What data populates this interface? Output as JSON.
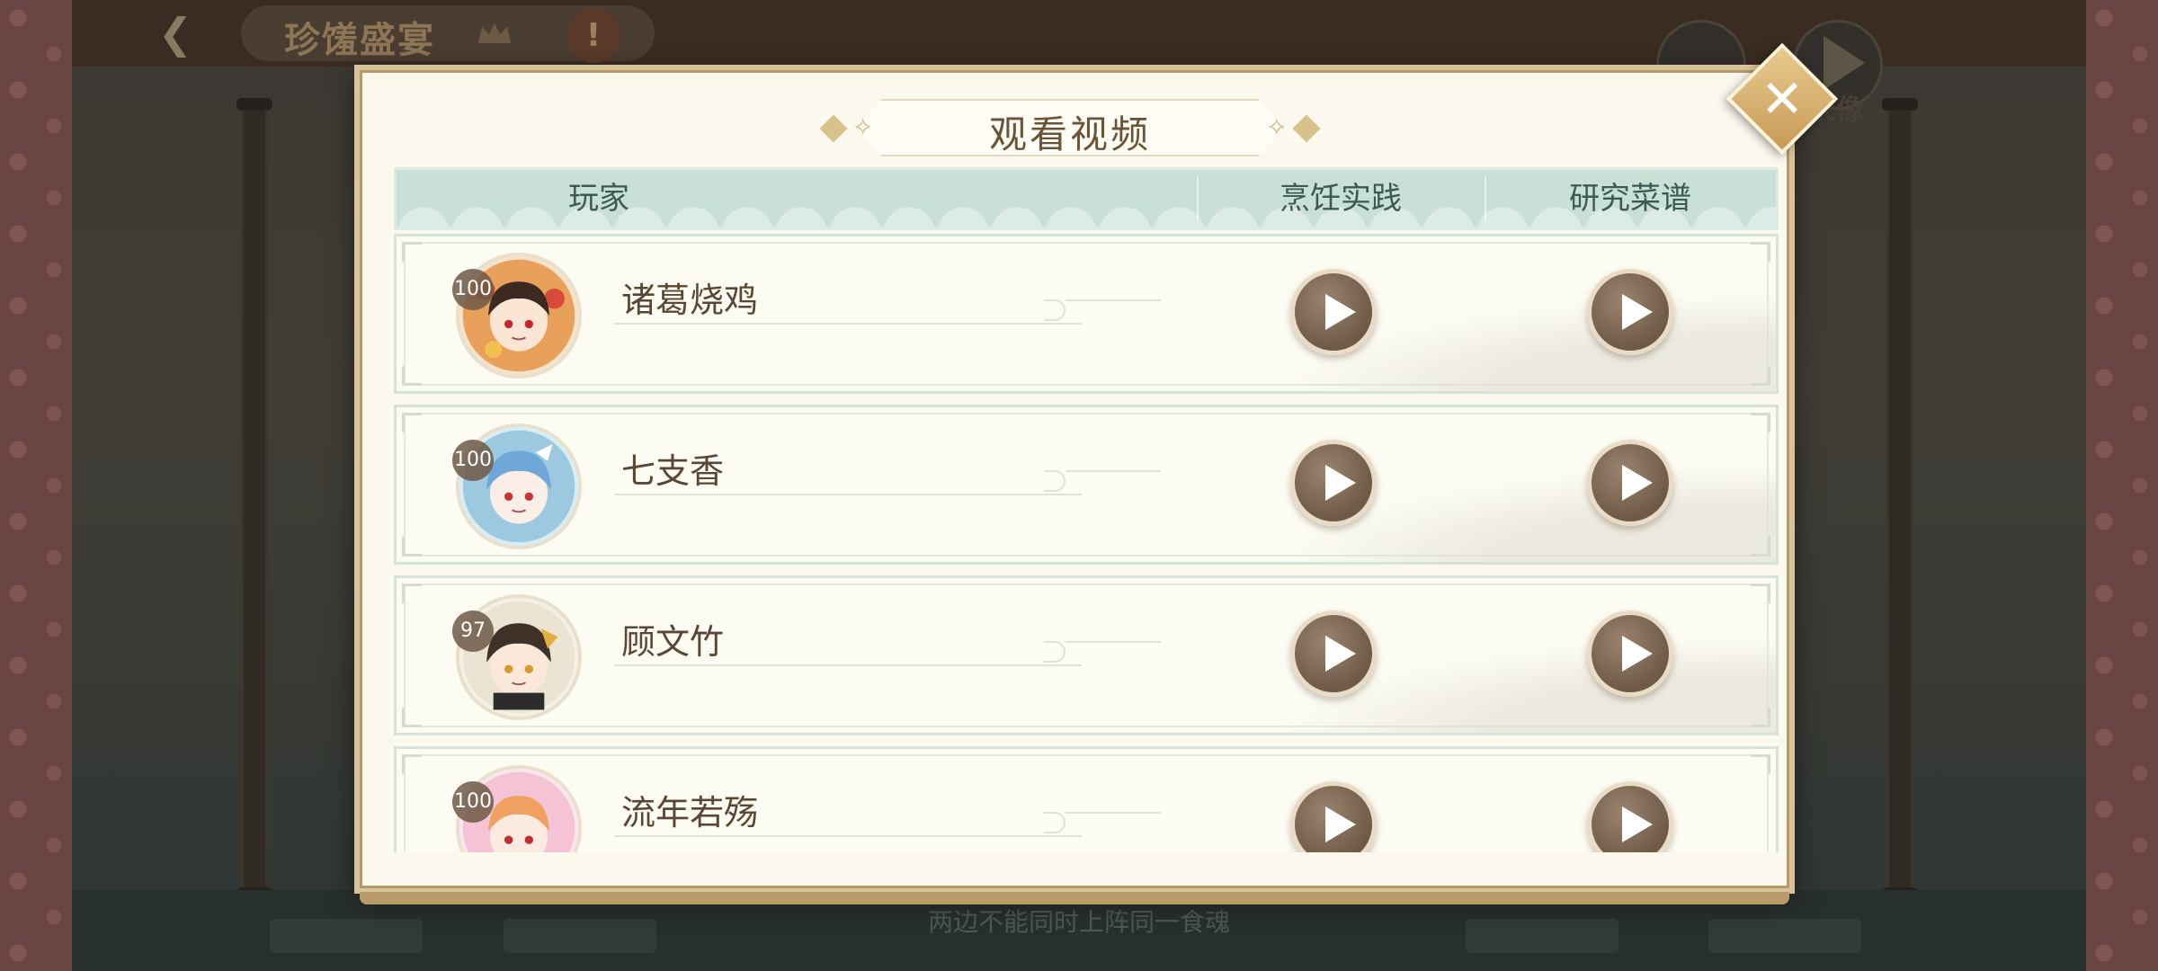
{
  "background": {
    "title": "珍馐盛宴",
    "record_label": "录像",
    "footer_note": "两边不能同时上阵同一食魂"
  },
  "dialog": {
    "title": "观看视频",
    "columns": {
      "player": "玩家",
      "cooking": "烹饪实践",
      "recipe": "研究菜谱"
    },
    "rows": [
      {
        "name": "诸葛烧鸡",
        "level": "100"
      },
      {
        "name": "七支香",
        "level": "100"
      },
      {
        "name": "顾文竹",
        "level": "97"
      },
      {
        "name": "流年若殇",
        "level": "100"
      }
    ]
  },
  "icons": {
    "close": "close-icon",
    "play": "play-icon",
    "back": "back-arrow-icon",
    "crown": "crown-icon",
    "warning": "warning-icon"
  },
  "colors": {
    "dialog_bg": "#fbf8ee",
    "header_teal": "#c9e0d6",
    "play_brown": "#7a6350",
    "close_gold": "#d7b173",
    "title_text": "#6a5435"
  }
}
